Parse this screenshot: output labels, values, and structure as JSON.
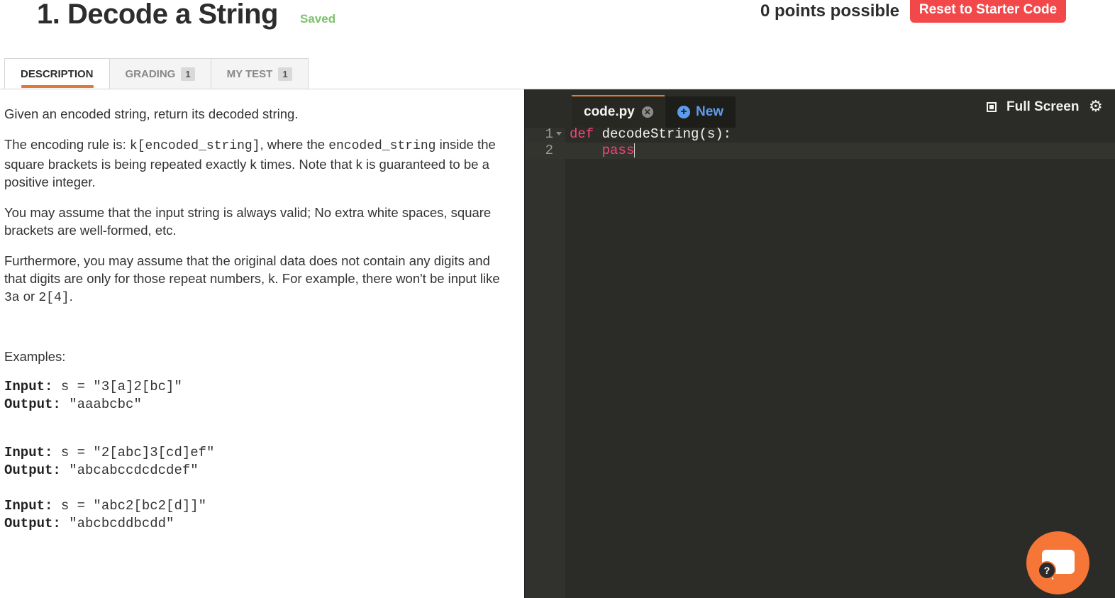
{
  "header": {
    "title": "1. Decode a String",
    "status": "Saved",
    "points": "0 points possible",
    "reset_label": "Reset to Starter Code"
  },
  "tabs": [
    {
      "label": "DESCRIPTION",
      "badge": ""
    },
    {
      "label": "GRADING",
      "badge": "1"
    },
    {
      "label": "MY TEST",
      "badge": "1"
    }
  ],
  "description": {
    "p1": "Given an encoded string, return its decoded string.",
    "p2_pre": "The encoding rule is: ",
    "p2_code1": "k[encoded_string]",
    "p2_mid": ", where the ",
    "p2_code2": "encoded_string",
    "p2_post": " inside the square brackets is being repeated exactly k times. Note that k is guaranteed to be a positive integer.",
    "p3": "You may assume that the input string is always valid; No extra white spaces, square brackets are well-formed, etc.",
    "p4_pre": "Furthermore, you may assume that the original data does not contain any digits and that digits are only for those repeat numbers, k. For example, there won't be input like ",
    "p4_code1": "3a",
    "p4_mid": " or ",
    "p4_code2": "2[4]",
    "p4_post": ".",
    "examples_label": "Examples:"
  },
  "examples": [
    {
      "input_label": "Input:",
      "input": " s = \"3[a]2[bc]\"",
      "output_label": "Output:",
      "output": " \"aaabcbc\""
    },
    {
      "input_label": "Input:",
      "input": " s = \"2[abc]3[cd]ef\"",
      "output_label": "Output:",
      "output": " \"abcabccdcdcdef\""
    },
    {
      "input_label": "Input:",
      "input": " s = \"abc2[bc2[d]]\"",
      "output_label": "Output:",
      "output": " \"abcbcddbcdd\""
    }
  ],
  "editor": {
    "file_tab": "code.py",
    "new_tab": "New",
    "fullscreen_label": "Full Screen",
    "lines": [
      {
        "num": "1",
        "keyword": "def",
        "text": " decodeString(s):"
      },
      {
        "num": "2",
        "keyword": "pass",
        "text": ""
      }
    ]
  },
  "chat": {
    "help_glyph": "?"
  },
  "colors": {
    "accent": "#e07a3a",
    "reset_button": "#f2484a",
    "saved": "#7cc36a",
    "editor_bg": "#2b2b28",
    "keyword": "#f2477a",
    "new_tab": "#5c9ded",
    "chat": "#f57637"
  },
  "icons": {
    "close": "close-icon",
    "new": "plus-circle-icon",
    "fullscreen": "fullscreen-icon",
    "settings": "gear-icon",
    "chat": "chat-bubble-icon"
  }
}
